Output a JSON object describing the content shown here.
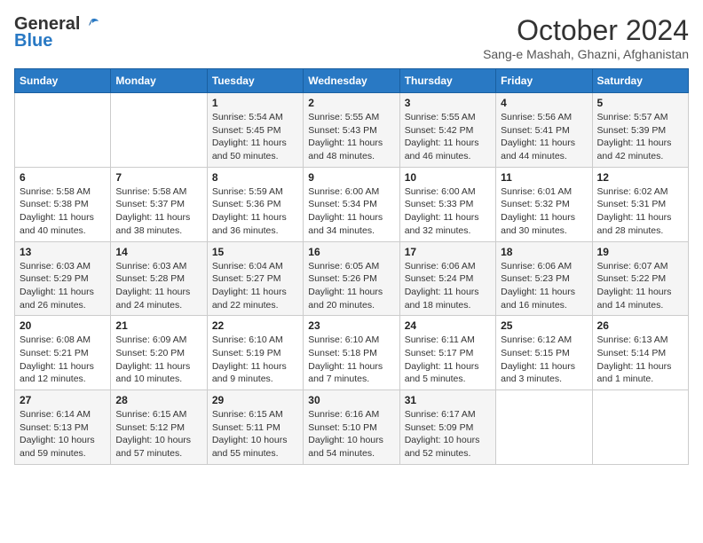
{
  "logo": {
    "general": "General",
    "blue": "Blue"
  },
  "header": {
    "month": "October 2024",
    "location": "Sang-e Mashah, Ghazni, Afghanistan"
  },
  "weekdays": [
    "Sunday",
    "Monday",
    "Tuesday",
    "Wednesday",
    "Thursday",
    "Friday",
    "Saturday"
  ],
  "weeks": [
    [
      {
        "day": "",
        "sunrise": "",
        "sunset": "",
        "daylight": ""
      },
      {
        "day": "",
        "sunrise": "",
        "sunset": "",
        "daylight": ""
      },
      {
        "day": "1",
        "sunrise": "Sunrise: 5:54 AM",
        "sunset": "Sunset: 5:45 PM",
        "daylight": "Daylight: 11 hours and 50 minutes."
      },
      {
        "day": "2",
        "sunrise": "Sunrise: 5:55 AM",
        "sunset": "Sunset: 5:43 PM",
        "daylight": "Daylight: 11 hours and 48 minutes."
      },
      {
        "day": "3",
        "sunrise": "Sunrise: 5:55 AM",
        "sunset": "Sunset: 5:42 PM",
        "daylight": "Daylight: 11 hours and 46 minutes."
      },
      {
        "day": "4",
        "sunrise": "Sunrise: 5:56 AM",
        "sunset": "Sunset: 5:41 PM",
        "daylight": "Daylight: 11 hours and 44 minutes."
      },
      {
        "day": "5",
        "sunrise": "Sunrise: 5:57 AM",
        "sunset": "Sunset: 5:39 PM",
        "daylight": "Daylight: 11 hours and 42 minutes."
      }
    ],
    [
      {
        "day": "6",
        "sunrise": "Sunrise: 5:58 AM",
        "sunset": "Sunset: 5:38 PM",
        "daylight": "Daylight: 11 hours and 40 minutes."
      },
      {
        "day": "7",
        "sunrise": "Sunrise: 5:58 AM",
        "sunset": "Sunset: 5:37 PM",
        "daylight": "Daylight: 11 hours and 38 minutes."
      },
      {
        "day": "8",
        "sunrise": "Sunrise: 5:59 AM",
        "sunset": "Sunset: 5:36 PM",
        "daylight": "Daylight: 11 hours and 36 minutes."
      },
      {
        "day": "9",
        "sunrise": "Sunrise: 6:00 AM",
        "sunset": "Sunset: 5:34 PM",
        "daylight": "Daylight: 11 hours and 34 minutes."
      },
      {
        "day": "10",
        "sunrise": "Sunrise: 6:00 AM",
        "sunset": "Sunset: 5:33 PM",
        "daylight": "Daylight: 11 hours and 32 minutes."
      },
      {
        "day": "11",
        "sunrise": "Sunrise: 6:01 AM",
        "sunset": "Sunset: 5:32 PM",
        "daylight": "Daylight: 11 hours and 30 minutes."
      },
      {
        "day": "12",
        "sunrise": "Sunrise: 6:02 AM",
        "sunset": "Sunset: 5:31 PM",
        "daylight": "Daylight: 11 hours and 28 minutes."
      }
    ],
    [
      {
        "day": "13",
        "sunrise": "Sunrise: 6:03 AM",
        "sunset": "Sunset: 5:29 PM",
        "daylight": "Daylight: 11 hours and 26 minutes."
      },
      {
        "day": "14",
        "sunrise": "Sunrise: 6:03 AM",
        "sunset": "Sunset: 5:28 PM",
        "daylight": "Daylight: 11 hours and 24 minutes."
      },
      {
        "day": "15",
        "sunrise": "Sunrise: 6:04 AM",
        "sunset": "Sunset: 5:27 PM",
        "daylight": "Daylight: 11 hours and 22 minutes."
      },
      {
        "day": "16",
        "sunrise": "Sunrise: 6:05 AM",
        "sunset": "Sunset: 5:26 PM",
        "daylight": "Daylight: 11 hours and 20 minutes."
      },
      {
        "day": "17",
        "sunrise": "Sunrise: 6:06 AM",
        "sunset": "Sunset: 5:24 PM",
        "daylight": "Daylight: 11 hours and 18 minutes."
      },
      {
        "day": "18",
        "sunrise": "Sunrise: 6:06 AM",
        "sunset": "Sunset: 5:23 PM",
        "daylight": "Daylight: 11 hours and 16 minutes."
      },
      {
        "day": "19",
        "sunrise": "Sunrise: 6:07 AM",
        "sunset": "Sunset: 5:22 PM",
        "daylight": "Daylight: 11 hours and 14 minutes."
      }
    ],
    [
      {
        "day": "20",
        "sunrise": "Sunrise: 6:08 AM",
        "sunset": "Sunset: 5:21 PM",
        "daylight": "Daylight: 11 hours and 12 minutes."
      },
      {
        "day": "21",
        "sunrise": "Sunrise: 6:09 AM",
        "sunset": "Sunset: 5:20 PM",
        "daylight": "Daylight: 11 hours and 10 minutes."
      },
      {
        "day": "22",
        "sunrise": "Sunrise: 6:10 AM",
        "sunset": "Sunset: 5:19 PM",
        "daylight": "Daylight: 11 hours and 9 minutes."
      },
      {
        "day": "23",
        "sunrise": "Sunrise: 6:10 AM",
        "sunset": "Sunset: 5:18 PM",
        "daylight": "Daylight: 11 hours and 7 minutes."
      },
      {
        "day": "24",
        "sunrise": "Sunrise: 6:11 AM",
        "sunset": "Sunset: 5:17 PM",
        "daylight": "Daylight: 11 hours and 5 minutes."
      },
      {
        "day": "25",
        "sunrise": "Sunrise: 6:12 AM",
        "sunset": "Sunset: 5:15 PM",
        "daylight": "Daylight: 11 hours and 3 minutes."
      },
      {
        "day": "26",
        "sunrise": "Sunrise: 6:13 AM",
        "sunset": "Sunset: 5:14 PM",
        "daylight": "Daylight: 11 hours and 1 minute."
      }
    ],
    [
      {
        "day": "27",
        "sunrise": "Sunrise: 6:14 AM",
        "sunset": "Sunset: 5:13 PM",
        "daylight": "Daylight: 10 hours and 59 minutes."
      },
      {
        "day": "28",
        "sunrise": "Sunrise: 6:15 AM",
        "sunset": "Sunset: 5:12 PM",
        "daylight": "Daylight: 10 hours and 57 minutes."
      },
      {
        "day": "29",
        "sunrise": "Sunrise: 6:15 AM",
        "sunset": "Sunset: 5:11 PM",
        "daylight": "Daylight: 10 hours and 55 minutes."
      },
      {
        "day": "30",
        "sunrise": "Sunrise: 6:16 AM",
        "sunset": "Sunset: 5:10 PM",
        "daylight": "Daylight: 10 hours and 54 minutes."
      },
      {
        "day": "31",
        "sunrise": "Sunrise: 6:17 AM",
        "sunset": "Sunset: 5:09 PM",
        "daylight": "Daylight: 10 hours and 52 minutes."
      },
      {
        "day": "",
        "sunrise": "",
        "sunset": "",
        "daylight": ""
      },
      {
        "day": "",
        "sunrise": "",
        "sunset": "",
        "daylight": ""
      }
    ]
  ]
}
